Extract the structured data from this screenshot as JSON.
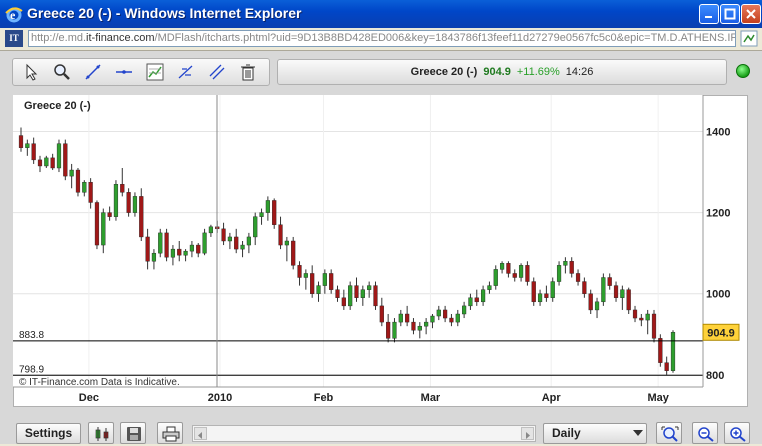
{
  "window": {
    "title": "Greece 20 (-) - Windows Internet Explorer"
  },
  "address": {
    "url_prefix": "http://e.md.",
    "url_domain": "it-finance.com",
    "url_rest": "/MDFlash/itcharts.phtml?uid=9D13B8BD428ED006&key=1843786f13feef11d27279e0567fc5c0&epic=TM.D.ATHENS.IFD"
  },
  "toolbar": {
    "tools": [
      "pointer-tool",
      "zoom-tool",
      "trend-line-tool",
      "horizontal-line-tool",
      "study-tool",
      "fibonacci-tool",
      "parallel-tool",
      "delete-tool"
    ]
  },
  "quote": {
    "name": "Greece 20 (-)",
    "price": "904.9",
    "change": "+11.69%",
    "time": "14:26"
  },
  "chart_data": {
    "type": "candlestick",
    "title": "Greece 20 (-)",
    "footer": "© IT-Finance.com Data is Indicative.",
    "y_ticks": [
      "1400",
      "1200",
      "1000",
      "800"
    ],
    "ylim": [
      770,
      1490
    ],
    "x_ticks": [
      "Dec",
      "2010",
      "Feb",
      "Mar",
      "Apr",
      "May"
    ],
    "last_price_label": "904.9",
    "horizontal_lines": [
      {
        "label": "883.8",
        "value": 883.8
      },
      {
        "label": "798.9",
        "value": 798.9
      }
    ],
    "colors": {
      "up": "#2e9e2e",
      "down": "#a01818",
      "wick": "#333333"
    },
    "ohlc": [
      [
        1390,
        1410,
        1350,
        1360
      ],
      [
        1360,
        1380,
        1340,
        1370
      ],
      [
        1370,
        1385,
        1320,
        1330
      ],
      [
        1330,
        1340,
        1300,
        1315
      ],
      [
        1315,
        1340,
        1310,
        1335
      ],
      [
        1335,
        1345,
        1305,
        1310
      ],
      [
        1310,
        1380,
        1300,
        1370
      ],
      [
        1370,
        1380,
        1280,
        1290
      ],
      [
        1290,
        1320,
        1260,
        1305
      ],
      [
        1305,
        1310,
        1240,
        1250
      ],
      [
        1250,
        1280,
        1240,
        1275
      ],
      [
        1275,
        1285,
        1210,
        1225
      ],
      [
        1225,
        1230,
        1110,
        1120
      ],
      [
        1120,
        1210,
        1100,
        1200
      ],
      [
        1200,
        1215,
        1180,
        1190
      ],
      [
        1190,
        1280,
        1180,
        1270
      ],
      [
        1270,
        1310,
        1240,
        1250
      ],
      [
        1250,
        1260,
        1190,
        1200
      ],
      [
        1200,
        1250,
        1190,
        1240
      ],
      [
        1240,
        1260,
        1130,
        1140
      ],
      [
        1140,
        1160,
        1060,
        1080
      ],
      [
        1080,
        1110,
        1060,
        1100
      ],
      [
        1100,
        1160,
        1090,
        1150
      ],
      [
        1150,
        1160,
        1080,
        1090
      ],
      [
        1090,
        1120,
        1070,
        1110
      ],
      [
        1110,
        1130,
        1080,
        1095
      ],
      [
        1095,
        1110,
        1080,
        1105
      ],
      [
        1105,
        1130,
        1090,
        1120
      ],
      [
        1120,
        1125,
        1090,
        1100
      ],
      [
        1100,
        1160,
        1095,
        1150
      ],
      [
        1150,
        1170,
        1140,
        1165
      ],
      [
        1165,
        1180,
        1150,
        1160
      ],
      [
        1160,
        1175,
        1120,
        1130
      ],
      [
        1130,
        1150,
        1110,
        1140
      ],
      [
        1140,
        1160,
        1100,
        1110
      ],
      [
        1110,
        1130,
        1090,
        1120
      ],
      [
        1120,
        1150,
        1100,
        1140
      ],
      [
        1140,
        1200,
        1120,
        1190
      ],
      [
        1190,
        1210,
        1170,
        1200
      ],
      [
        1200,
        1240,
        1180,
        1230
      ],
      [
        1230,
        1235,
        1160,
        1170
      ],
      [
        1170,
        1190,
        1110,
        1120
      ],
      [
        1120,
        1140,
        1080,
        1130
      ],
      [
        1130,
        1140,
        1060,
        1070
      ],
      [
        1070,
        1080,
        1020,
        1040
      ],
      [
        1040,
        1060,
        1010,
        1050
      ],
      [
        1050,
        1070,
        990,
        1000
      ],
      [
        1000,
        1030,
        980,
        1020
      ],
      [
        1020,
        1060,
        1000,
        1050
      ],
      [
        1050,
        1060,
        1000,
        1010
      ],
      [
        1010,
        1020,
        980,
        990
      ],
      [
        990,
        1010,
        960,
        970
      ],
      [
        970,
        1030,
        960,
        1020
      ],
      [
        1020,
        1040,
        980,
        990
      ],
      [
        990,
        1020,
        970,
        1010
      ],
      [
        1010,
        1030,
        990,
        1020
      ],
      [
        1020,
        1030,
        960,
        970
      ],
      [
        970,
        990,
        920,
        930
      ],
      [
        930,
        950,
        880,
        890
      ],
      [
        890,
        940,
        880,
        930
      ],
      [
        930,
        960,
        920,
        950
      ],
      [
        950,
        970,
        920,
        930
      ],
      [
        930,
        940,
        900,
        910
      ],
      [
        910,
        930,
        890,
        920
      ],
      [
        920,
        940,
        900,
        930
      ],
      [
        930,
        950,
        915,
        945
      ],
      [
        945,
        970,
        935,
        960
      ],
      [
        960,
        970,
        930,
        940
      ],
      [
        940,
        950,
        920,
        930
      ],
      [
        930,
        960,
        920,
        950
      ],
      [
        950,
        980,
        940,
        970
      ],
      [
        970,
        1000,
        960,
        990
      ],
      [
        990,
        1010,
        970,
        980
      ],
      [
        980,
        1020,
        970,
        1010
      ],
      [
        1010,
        1030,
        1000,
        1020
      ],
      [
        1020,
        1070,
        1010,
        1060
      ],
      [
        1060,
        1080,
        1050,
        1075
      ],
      [
        1075,
        1080,
        1040,
        1050
      ],
      [
        1050,
        1060,
        1030,
        1040
      ],
      [
        1040,
        1075,
        1030,
        1070
      ],
      [
        1070,
        1080,
        1020,
        1030
      ],
      [
        1030,
        1040,
        970,
        980
      ],
      [
        980,
        1010,
        970,
        1000
      ],
      [
        1000,
        1020,
        980,
        990
      ],
      [
        990,
        1040,
        980,
        1030
      ],
      [
        1030,
        1080,
        1020,
        1070
      ],
      [
        1070,
        1090,
        1050,
        1080
      ],
      [
        1080,
        1090,
        1040,
        1050
      ],
      [
        1050,
        1060,
        1020,
        1030
      ],
      [
        1030,
        1040,
        990,
        1000
      ],
      [
        1000,
        1010,
        950,
        960
      ],
      [
        960,
        990,
        940,
        980
      ],
      [
        980,
        1050,
        970,
        1040
      ],
      [
        1040,
        1050,
        1010,
        1020
      ],
      [
        1020,
        1030,
        980,
        990
      ],
      [
        990,
        1020,
        960,
        1010
      ],
      [
        1010,
        1015,
        950,
        960
      ],
      [
        960,
        970,
        930,
        940
      ],
      [
        940,
        950,
        920,
        935
      ],
      [
        935,
        960,
        900,
        950
      ],
      [
        950,
        960,
        880,
        890
      ],
      [
        890,
        900,
        820,
        830
      ],
      [
        830,
        845,
        800,
        810
      ],
      [
        810,
        910,
        805,
        905
      ]
    ]
  },
  "bottom": {
    "settings_label": "Settings",
    "interval_value": "Daily"
  }
}
